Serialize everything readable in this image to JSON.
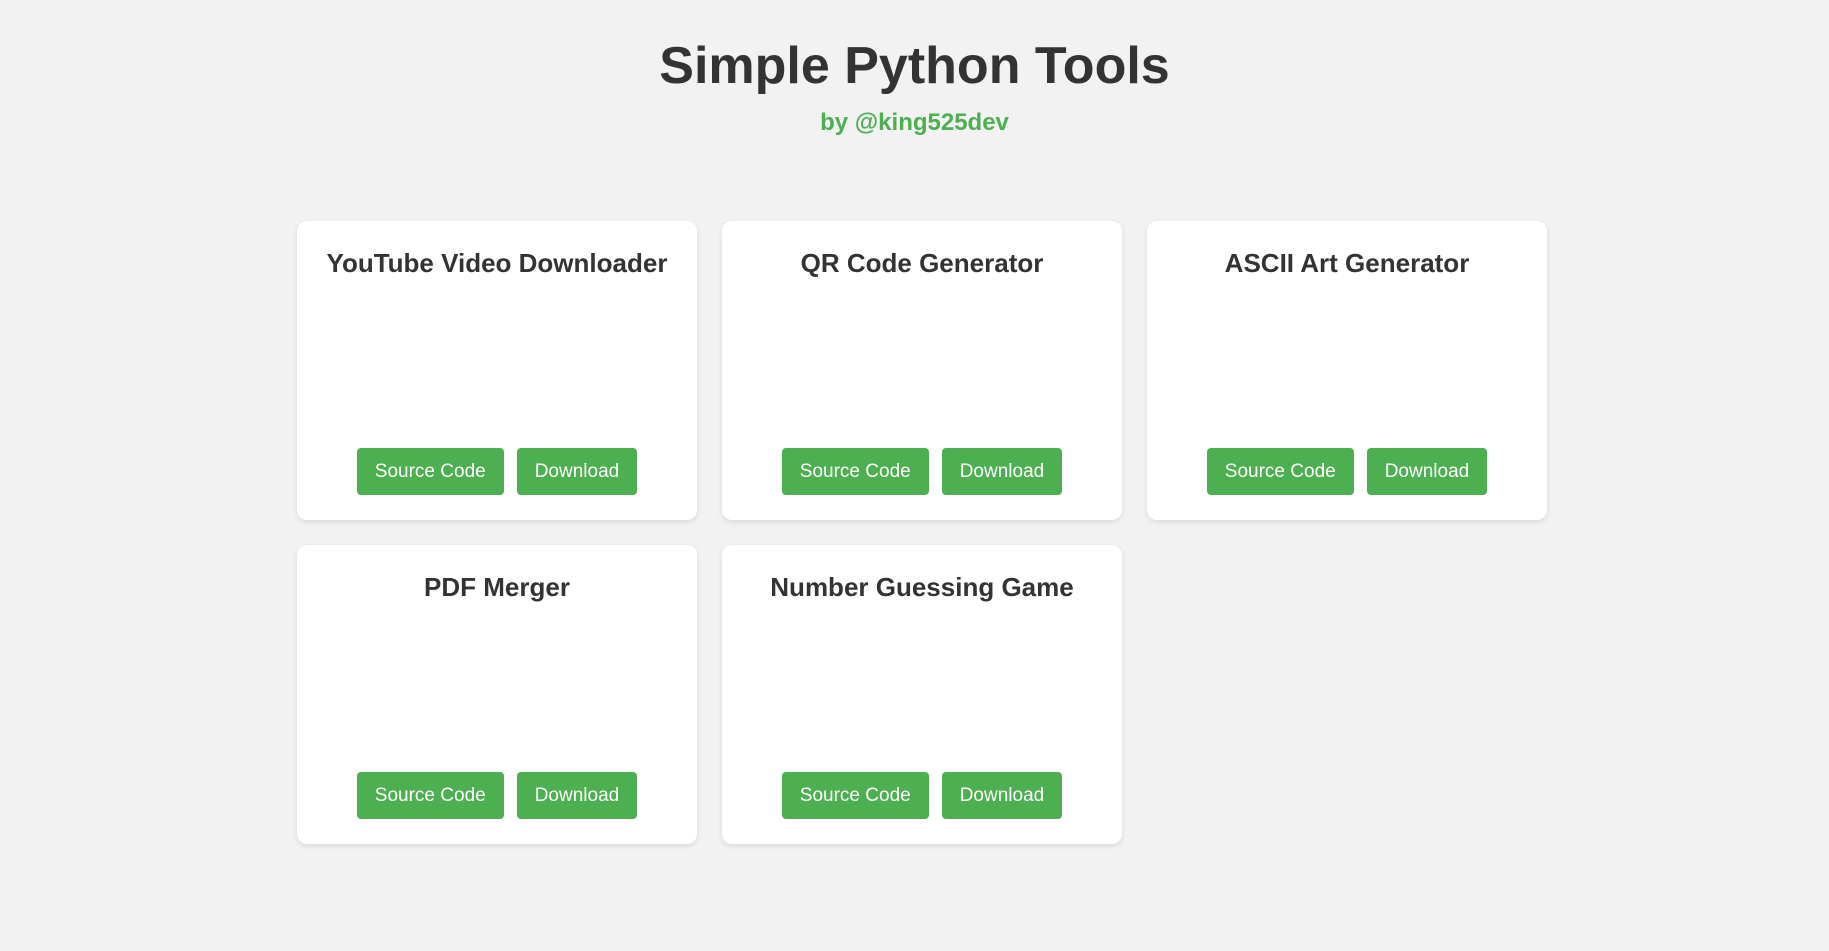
{
  "header": {
    "title": "Simple Python Tools",
    "subtitle": "by @king525dev"
  },
  "tools": [
    {
      "name": "YouTube Video Downloader",
      "source_label": "Source Code",
      "download_label": "Download"
    },
    {
      "name": "QR Code Generator",
      "source_label": "Source Code",
      "download_label": "Download"
    },
    {
      "name": "ASCII Art Generator",
      "source_label": "Source Code",
      "download_label": "Download"
    },
    {
      "name": "PDF Merger",
      "source_label": "Source Code",
      "download_label": "Download"
    },
    {
      "name": "Number Guessing Game",
      "source_label": "Source Code",
      "download_label": "Download"
    }
  ],
  "colors": {
    "background": "#f2f2f2",
    "card": "#ffffff",
    "accent": "#4caf50",
    "title_text": "#333333"
  }
}
